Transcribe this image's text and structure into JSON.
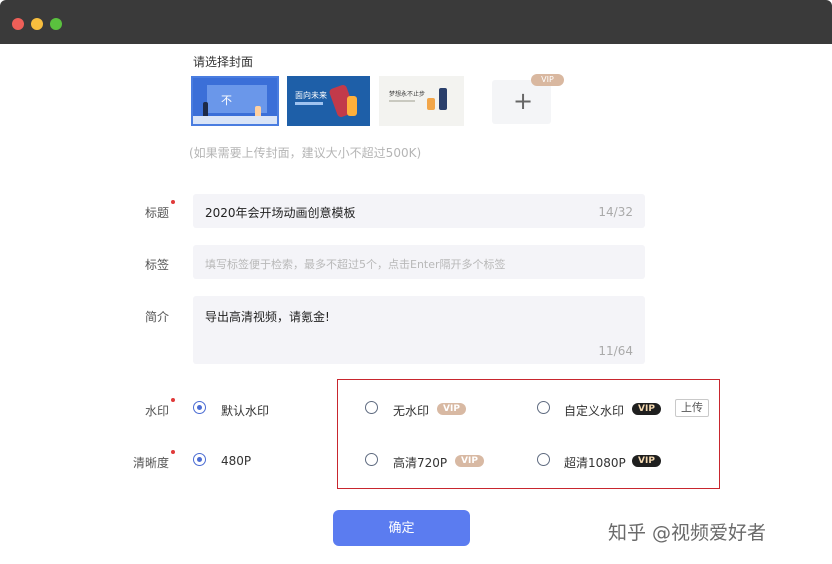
{
  "cover": {
    "title": "请选择封面",
    "thumb1_text": "不",
    "thumb2_text": "面向未来",
    "thumb3_text": "梦想永不止步",
    "add_symbol": "+",
    "vip_badge": "VIP",
    "hint": "(如果需要上传封面，建议大小不超过500K)"
  },
  "title_field": {
    "label": "标题",
    "value": "2020年会开场动画创意模板",
    "counter": "14/32"
  },
  "tags_field": {
    "label": "标签",
    "placeholder": "填写标签便于检索，最多不超过5个，点击Enter隔开多个标签"
  },
  "intro_field": {
    "label": "简介",
    "value": "导出高清视频，请氪金!",
    "counter": "11/64"
  },
  "watermark_row": {
    "label": "水印",
    "default_option": "默认水印",
    "no_watermark": "无水印",
    "no_watermark_badge": "VIP",
    "custom_watermark": "自定义水印",
    "custom_watermark_badge": "VIP",
    "upload_button": "上传"
  },
  "resolution_row": {
    "label": "清晰度",
    "default_option": "480P",
    "hd_option": "高清720P",
    "hd_badge": "VIP",
    "uhd_option": "超清1080P",
    "uhd_badge": "VIP"
  },
  "confirm_button": "确定",
  "watermark_text": "知乎 @视频爱好者",
  "colors": {
    "accent": "#5b7cf0",
    "highlight_border": "#c8262e",
    "required_dot": "#e03a3a"
  }
}
